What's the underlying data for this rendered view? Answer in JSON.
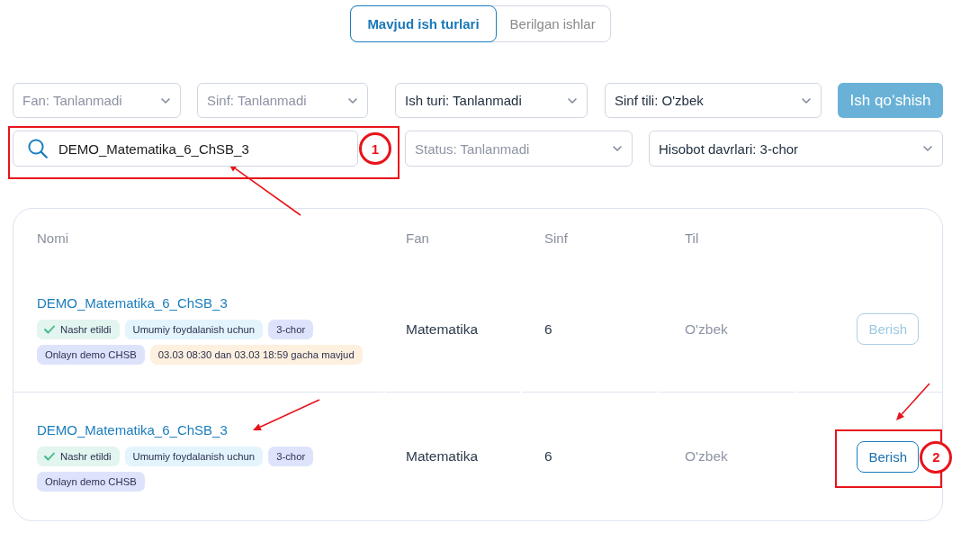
{
  "tabs": [
    {
      "label": "Mavjud ish turlari",
      "selected": true
    },
    {
      "label": "Berilgan ishlar",
      "selected": false
    }
  ],
  "filter_rows": [
    [
      {
        "kind": "select",
        "placeholder": "Fan: Tanlanmadi"
      },
      {
        "kind": "select",
        "placeholder": "Sinf: Tanlanmadi"
      },
      {
        "kind": "select",
        "value": "Ish turi: Tanlanmadi"
      },
      {
        "kind": "select",
        "value": "Sinf tili: O'zbek"
      },
      {
        "kind": "button",
        "label": "Ish qo‘shish",
        "disabled": true
      }
    ],
    [
      {
        "kind": "search",
        "value": "DEMO_Matematika_6_ChSB_3",
        "callout": "1"
      },
      {
        "kind": "select",
        "placeholder": "Status: Tanlanmadi"
      },
      {
        "kind": "select",
        "value": "Hisobot davrlari: 3-chor"
      }
    ]
  ],
  "table": {
    "columns": [
      "Nomi",
      "Fan",
      "Sinf",
      "Til"
    ],
    "rows": [
      {
        "name": "DEMO_Matematika_6_ChSB_3",
        "tags": [
          {
            "kind": "status",
            "label": "Nashr etildi",
            "color": "#e2f5ee"
          },
          {
            "kind": "plain",
            "label": "Umumiy foydalanish uchun",
            "color": "#e3f4fc"
          },
          {
            "kind": "plain",
            "label": "3-chor",
            "color": "#dee3fc"
          },
          {
            "kind": "plain",
            "label": "Onlayn demo CHSB",
            "color": "#dee3fc"
          },
          {
            "kind": "plain",
            "label": "03.03 08:30 dan 03.03 18:59 gacha mavjud",
            "color": "#fdf0de"
          }
        ],
        "subject": "Matematika",
        "grade": "6",
        "language": "O'zbek",
        "action": {
          "label": "Berish",
          "disabled": true
        }
      },
      {
        "name": "DEMO_Matematika_6_ChSB_3",
        "tags": [
          {
            "kind": "status",
            "label": "Nashr etildi",
            "color": "#e2f5ee"
          },
          {
            "kind": "plain",
            "label": "Umumiy foydalanish uchun",
            "color": "#e3f4fc"
          },
          {
            "kind": "plain",
            "label": "3-chor",
            "color": "#dee3fc"
          },
          {
            "kind": "plain",
            "label": "Onlayn demo CHSB",
            "color": "#dee3fc"
          }
        ],
        "subject": "Matematika",
        "grade": "6",
        "language": "O'zbek",
        "action": {
          "label": "Berish",
          "disabled": false,
          "callout": "2"
        }
      }
    ]
  }
}
